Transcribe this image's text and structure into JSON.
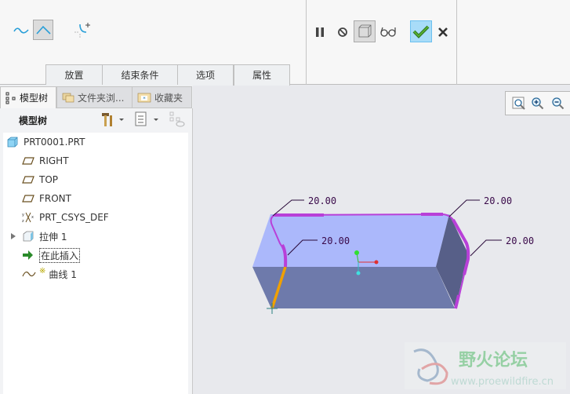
{
  "ribbon": {
    "icons": [
      "spline-curve-icon",
      "polyline-curve-icon",
      "curve-end-condition-icon",
      "pause-icon",
      "no-preview-icon",
      "verify-preview-icon",
      "glasses-preview-icon",
      "confirm-check-icon",
      "cancel-x-icon"
    ],
    "tabs": [
      {
        "label": "放置"
      },
      {
        "label": "结束条件"
      },
      {
        "label": "选项"
      },
      {
        "label": "属性"
      }
    ]
  },
  "left_panel": {
    "tabs": [
      {
        "label": "模型树"
      },
      {
        "label": "文件夹浏..."
      },
      {
        "label": "收藏夹"
      }
    ],
    "header_label": "模型树",
    "tree": [
      {
        "label": "PRT0001.PRT",
        "icon": "part-icon"
      },
      {
        "label": "RIGHT",
        "icon": "datum-plane-icon"
      },
      {
        "label": "TOP",
        "icon": "datum-plane-icon"
      },
      {
        "label": "FRONT",
        "icon": "datum-plane-icon"
      },
      {
        "label": "PRT_CSYS_DEF",
        "icon": "csys-icon"
      },
      {
        "label": "拉伸 1",
        "icon": "extrude-icon"
      },
      {
        "label": "在此插入",
        "icon": "insert-arrow-icon"
      },
      {
        "label": "曲线 1",
        "icon": "curve-icon",
        "marker": "※"
      }
    ]
  },
  "viewport": {
    "dimensions": [
      "20.00",
      "20.00",
      "20.00",
      "20.00"
    ],
    "watermark": {
      "title": "野火论坛",
      "url": "www.proewildfire.cn"
    }
  },
  "colors": {
    "curve": "#b840d8",
    "selected_edge": "#f0a000",
    "top_face": "#abb8fb",
    "front_face": "#6e7aab",
    "side_face": "#575f88"
  }
}
